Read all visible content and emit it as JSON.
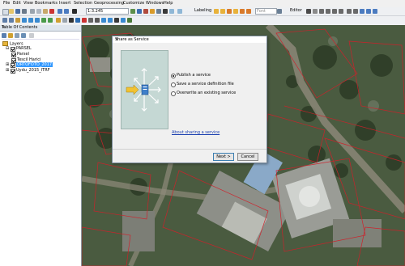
{
  "menu": [
    "File",
    "Edit",
    "View",
    "Bookmarks",
    "Insert",
    "Selection",
    "Geoprocessing",
    "Customize",
    "Windows",
    "Help"
  ],
  "toolbar": {
    "scale": "1:3.245",
    "labeling": "Labeling",
    "font_field": "Font",
    "editor": "Editor"
  },
  "toc": {
    "title": "Table Of Contents",
    "close": "×",
    "layers_label": "Layers",
    "items": [
      {
        "label": "PARSEL",
        "checked": true,
        "indent": 1
      },
      {
        "label": "Parsel",
        "checked": true,
        "indent": 2
      },
      {
        "label": "Tescil Harici",
        "checked": true,
        "indent": 2
      },
      {
        "label": "ORTOFOTO_2017",
        "checked": true,
        "indent": 1,
        "selected": true
      },
      {
        "label": "Uydu_2015_ITRF",
        "checked": true,
        "indent": 1
      }
    ]
  },
  "dialog": {
    "title": "Share as Service",
    "close": "×",
    "options": [
      {
        "label": "Publish a service",
        "selected": true
      },
      {
        "label": "Save a service definition file",
        "selected": false
      },
      {
        "label": "Overwrite an existing service",
        "selected": false
      }
    ],
    "link": "About sharing a service",
    "next_button": "Next >",
    "cancel_button": "Cancel"
  },
  "colors": {
    "selection_highlight": "#3399ff",
    "parcel_line": "#d0202a",
    "illustration_bg": "#c5d8d4",
    "link": "#1a3fb0"
  }
}
